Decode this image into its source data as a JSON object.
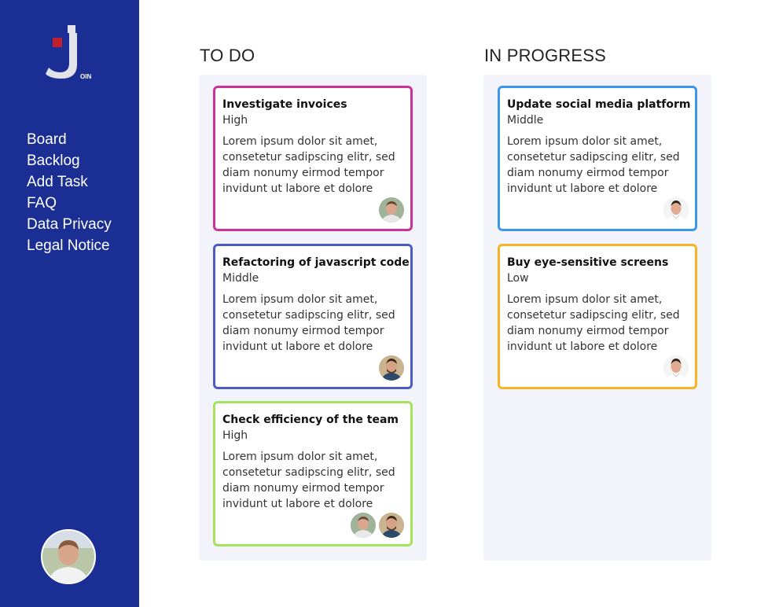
{
  "sidebar": {
    "logo_text": "OIN",
    "nav": [
      "Board",
      "Backlog",
      "Add Task",
      "FAQ",
      "Data Privacy",
      "Legal Notice"
    ]
  },
  "columns": [
    {
      "title": "TO DO",
      "cards": [
        {
          "title": "Investigate invoices",
          "priority": "High",
          "description": "Lorem ipsum dolor sit amet, consetetur sadipscing elitr, sed diam nonumy eirmod tempor invidunt ut labore et dolore",
          "border_color": "#cc3399"
        },
        {
          "title": "Refactoring of javascript code",
          "priority": "Middle",
          "description": "Lorem ipsum dolor sit amet, consetetur sadipscing elitr, sed diam nonumy eirmod tempor invidunt ut labore et dolore",
          "border_color": "#4b5cc4"
        },
        {
          "title": "Check efficiency of the team",
          "priority": "High",
          "description": "Lorem ipsum dolor sit amet, consetetur sadipscing elitr, sed diam nonumy eirmod tempor invidunt ut labore et dolore",
          "border_color": "#a4e35a"
        }
      ]
    },
    {
      "title": "IN PROGRESS",
      "cards": [
        {
          "title": "Update social media platform",
          "priority": "Middle",
          "description": "Lorem ipsum dolor sit amet, consetetur sadipscing elitr, sed diam nonumy eirmod tempor invidunt ut labore et dolore",
          "border_color": "#3d96ee"
        },
        {
          "title": "Buy eye-sensitive screens",
          "priority": "Low",
          "description": "Lorem ipsum dolor sit amet, consetetur sadipscing elitr, sed diam nonumy eirmod tempor invidunt ut labore et dolore",
          "border_color": "#f6b324"
        }
      ]
    }
  ],
  "colors": {
    "sidebar": "#1b2e93",
    "column_bg": "#f3f3fb",
    "logo_red": "#c0202c"
  }
}
